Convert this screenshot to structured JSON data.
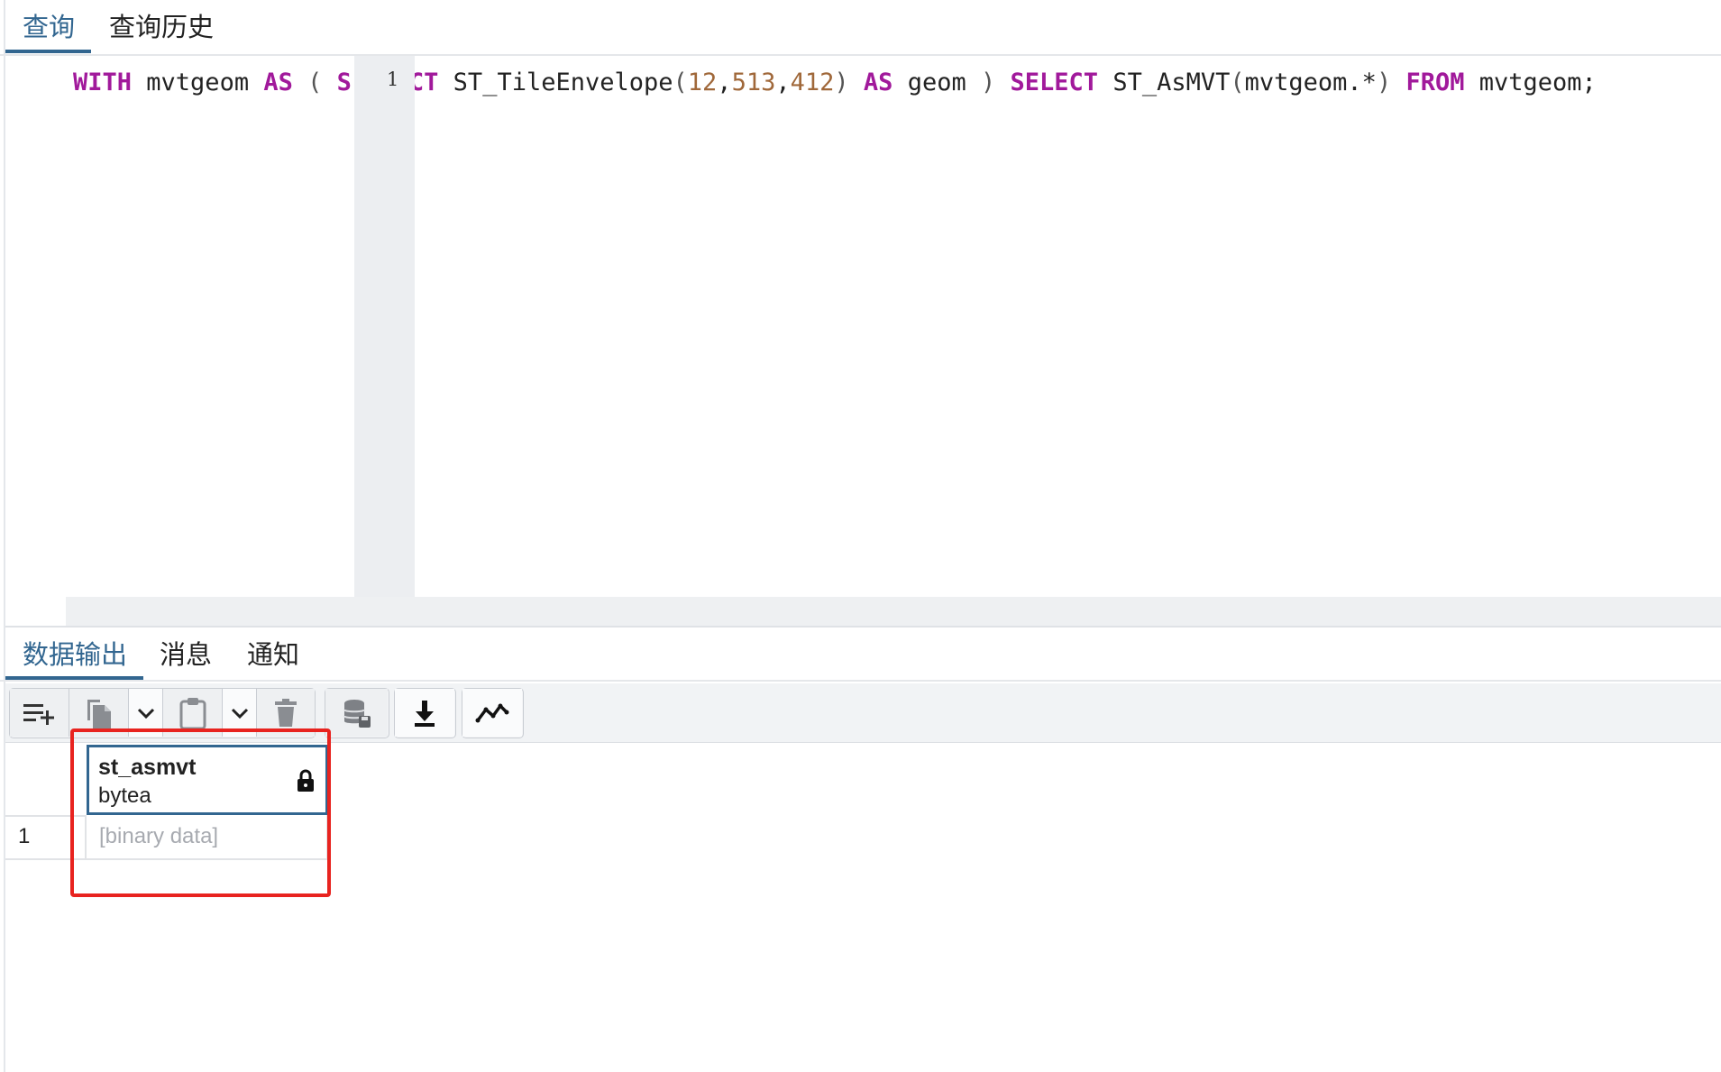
{
  "tabs": [
    {
      "label": "查询",
      "active": true
    },
    {
      "label": "查询历史",
      "active": false
    }
  ],
  "editor": {
    "line_number": "1",
    "code": {
      "t1": "WITH",
      "t2": " mvtgeom ",
      "t3": "AS",
      "t4": " ( ",
      "t5": "S",
      "t6": "CT",
      "t7": " ST_TileEnvelope",
      "t8": "(",
      "t9": "12",
      "t10": ",",
      "t11": "513",
      "t12": ",",
      "t13": "412",
      "t14": ")",
      "t15": " ",
      "t16": "AS",
      "t17": " geom ",
      "t18": ")",
      "t19": " ",
      "t20": "SELECT",
      "t21": " ST_AsMVT",
      "t22": "(",
      "t23": "mvtgeom.*",
      "t24": ")",
      "t25": " ",
      "t26": "FROM",
      "t27": " mvtgeom;"
    }
  },
  "output_tabs": [
    {
      "label": "数据输出",
      "active": true
    },
    {
      "label": "消息",
      "active": false
    },
    {
      "label": "通知",
      "active": false
    }
  ],
  "toolbar": {
    "icons": [
      "add-row-icon",
      "copy-icon",
      "chevron-down-icon",
      "paste-icon",
      "chevron-down-icon",
      "delete-icon",
      "save-data-icon",
      "download-icon",
      "graph-icon"
    ]
  },
  "grid": {
    "column": {
      "name": "st_asmvt",
      "type": "bytea",
      "locked": true
    },
    "rows": [
      {
        "num": "1",
        "value": "[binary data]"
      }
    ]
  },
  "colors": {
    "accent": "#326690",
    "keyword": "#a1199b",
    "number": "#a0683a",
    "highlight": "#e8231f"
  }
}
